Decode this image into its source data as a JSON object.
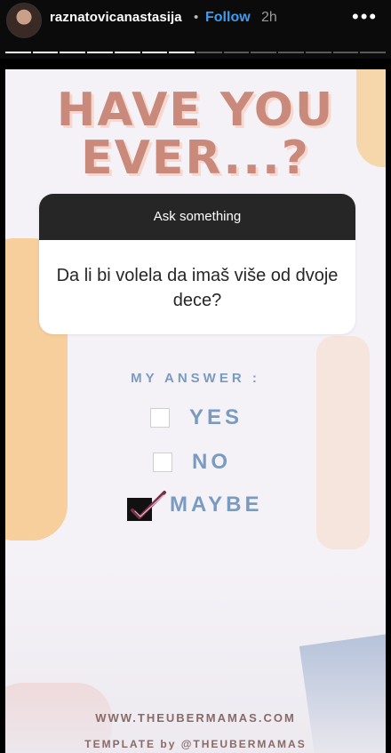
{
  "header": {
    "username": "raznatovicanastasija",
    "separator": "•",
    "follow_label": "Follow",
    "time": "2h",
    "more_label": "•••"
  },
  "progress": {
    "total_segments": 14,
    "completed_segments": 7
  },
  "story": {
    "headline_line1": "HAVE YOU",
    "headline_line2": "EVER...?",
    "question_sticker": {
      "header": "Ask something",
      "text": "Da li bi volela da imaš više od dvoje dece?"
    },
    "answer_title": "MY ANSWER :",
    "options": [
      {
        "label": "YES",
        "checked": false
      },
      {
        "label": "NO",
        "checked": false
      },
      {
        "label": "MAYBE",
        "checked": true
      }
    ],
    "footer_line1": "WWW.THEUBERMAMAS.COM",
    "footer_line2": "TEMPLATE by @THEUBERMAMAS"
  },
  "colors": {
    "follow": "#3e9cf0",
    "headline": "#c98a7c",
    "answer_text": "#7a9bc0",
    "check_mark": "#7a2f48"
  },
  "icons": {
    "more": "more-horizontal-icon",
    "check": "checkmark-icon"
  }
}
